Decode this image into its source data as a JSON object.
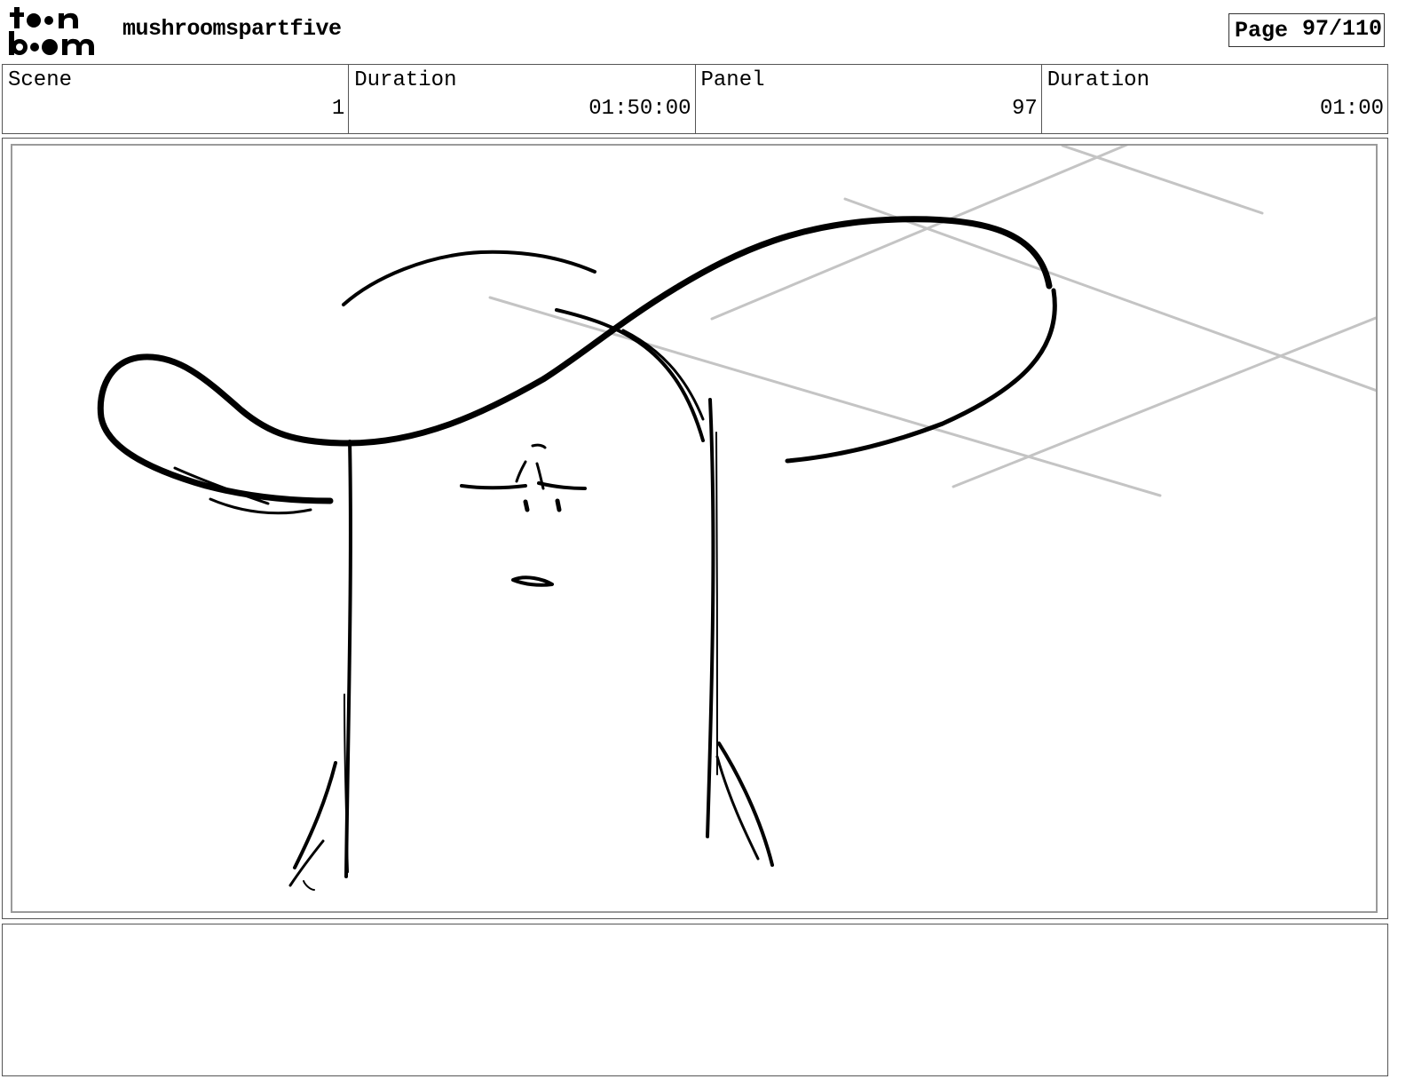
{
  "header": {
    "logo_text": "toon boom",
    "project_title": "mushroomspartfive",
    "page_label": "Page",
    "page_value": "97/110"
  },
  "info": {
    "scene_label": "Scene",
    "scene_value": "1",
    "scene_duration_label": "Duration",
    "scene_duration_value": "01:50:00",
    "panel_label": "Panel",
    "panel_value": "97",
    "panel_duration_label": "Duration",
    "panel_duration_value": "01:00"
  },
  "panel": {
    "drawing_icon": "mushroom-sketch"
  },
  "notes": {
    "text": ""
  }
}
